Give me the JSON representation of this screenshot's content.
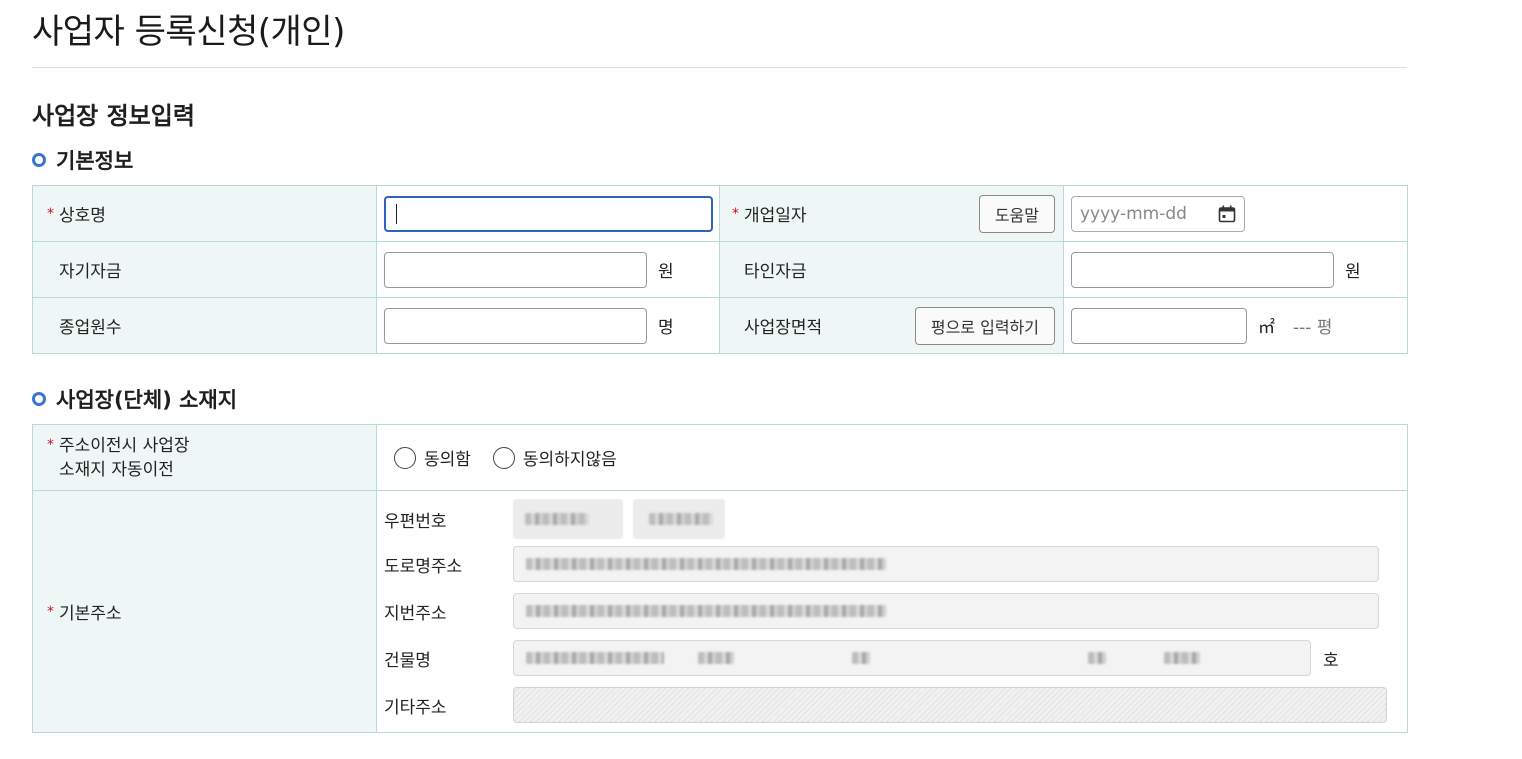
{
  "page": {
    "title": "사업자 등록신청(개인)",
    "section_title": "사업장 정보입력"
  },
  "basic_info": {
    "title": "기본정보",
    "trade_name_label": "상호명",
    "opening_date_label": "개업일자",
    "help_button": "도움말",
    "date_placeholder": "yyyy-mm-dd",
    "own_capital_label": "자기자금",
    "other_capital_label": "타인자금",
    "unit_won": "원",
    "employees_label": "종업원수",
    "unit_person": "명",
    "area_label": "사업장면적",
    "pyeong_button": "평으로 입력하기",
    "unit_sqm": "㎡",
    "pyeong_readout": "--- 평"
  },
  "location": {
    "title": "사업장(단체) 소재지",
    "auto_transfer_label_line1": "주소이전시 사업장",
    "auto_transfer_label_line2": "소재지 자동이전",
    "radio_agree": "동의함",
    "radio_disagree": "동의하지않음",
    "base_address_label": "기본주소",
    "postal_code_label": "우편번호",
    "road_address_label": "도로명주소",
    "lot_address_label": "지번주소",
    "building_label": "건물명",
    "unit_ho": "호",
    "other_address_label": "기타주소"
  },
  "colors": {
    "accent": "#3b74d6",
    "required": "#d0112b",
    "header_cell": "#eef7f6",
    "border": "#b9d8d8"
  }
}
